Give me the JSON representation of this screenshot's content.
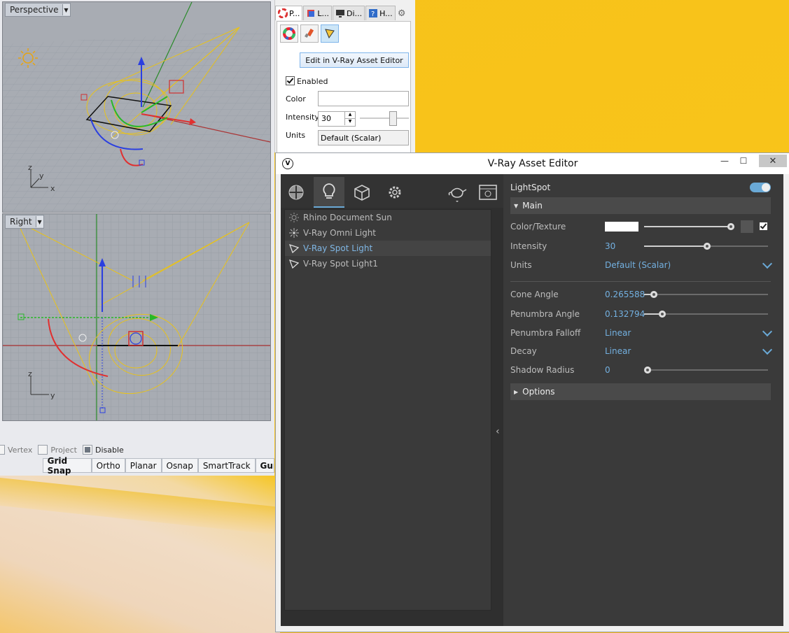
{
  "rhino": {
    "viewports": [
      {
        "title": "Perspective"
      },
      {
        "title": "Right"
      }
    ],
    "axes": {
      "x": "x",
      "y": "y",
      "z": "z"
    },
    "osnap": [
      {
        "label": "Vertex",
        "checked": false
      },
      {
        "label": "Project",
        "checked": false
      },
      {
        "label": "Disable",
        "checked": true
      }
    ],
    "status_buttons": [
      "Grid Snap",
      "Ortho",
      "Planar",
      "Osnap",
      "SmartTrack",
      "Gum"
    ]
  },
  "properties": {
    "tabs": [
      "P...",
      "L...",
      "Di...",
      "H..."
    ],
    "edit_button": "Edit in V-Ray Asset Editor",
    "enabled_label": "Enabled",
    "color_label": "Color",
    "intensity_label": "Intensity",
    "intensity_value": "30",
    "units_label": "Units",
    "units_value": "Default (Scalar)"
  },
  "vray": {
    "window_title": "V-Ray Asset Editor",
    "minimize": "—",
    "maximize": "☐",
    "close": "✕",
    "lights": [
      {
        "label": "Rhino Document Sun",
        "icon": "sun-icon",
        "selected": false
      },
      {
        "label": "V-Ray Omni Light",
        "icon": "omni-light-icon",
        "selected": false
      },
      {
        "label": "V-Ray Spot Light",
        "icon": "spot-light-icon",
        "selected": true
      },
      {
        "label": "V-Ray Spot Light1",
        "icon": "spot-light-icon",
        "selected": false
      }
    ],
    "panel": {
      "title": "LightSpot",
      "main_section": "Main",
      "options_section": "Options",
      "color_texture_label": "Color/Texture",
      "intensity_label": "Intensity",
      "intensity_value": "30",
      "units_label": "Units",
      "units_value": "Default (Scalar)",
      "cone_angle_label": "Cone Angle",
      "cone_angle_value": "0.265588",
      "penumbra_angle_label": "Penumbra Angle",
      "penumbra_angle_value": "0.132794",
      "penumbra_falloff_label": "Penumbra Falloff",
      "penumbra_falloff_value": "Linear",
      "decay_label": "Decay",
      "decay_value": "Linear",
      "shadow_radius_label": "Shadow Radius",
      "shadow_radius_value": "0"
    }
  }
}
